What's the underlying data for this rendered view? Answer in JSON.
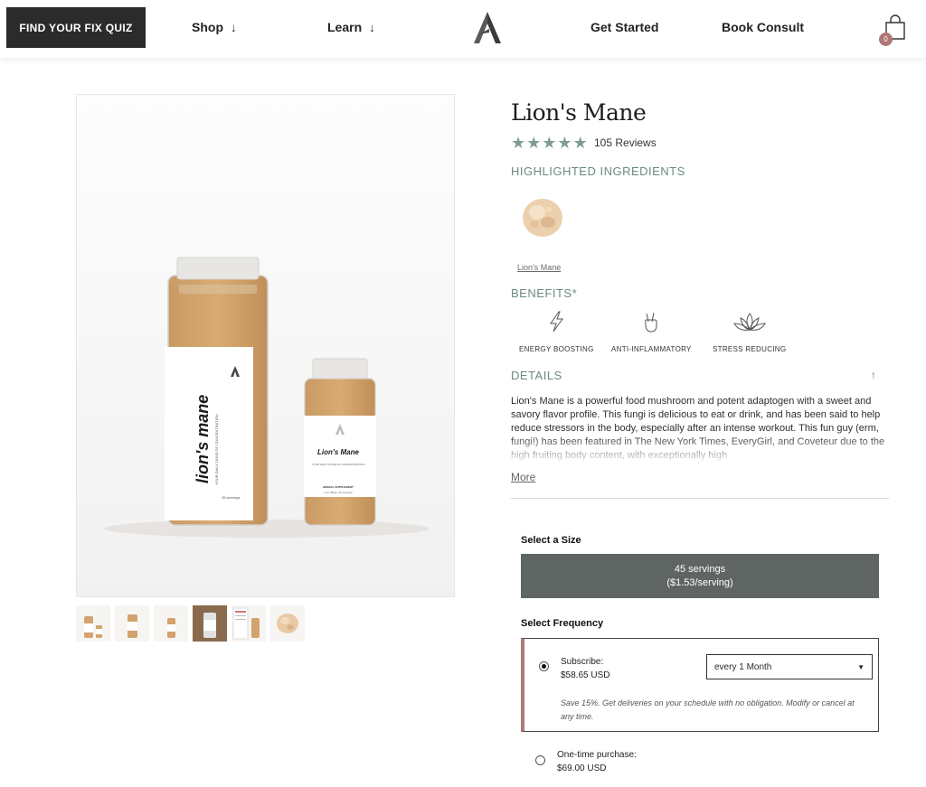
{
  "header": {
    "quiz_label": "FIND YOUR FIX QUIZ",
    "nav": {
      "shop": "Shop",
      "learn": "Learn",
      "get_started": "Get Started",
      "book_consult": "Book Consult"
    },
    "cart_count": "0"
  },
  "product": {
    "title": "Lion's Mane",
    "reviews": "105 Reviews",
    "rating_stars": 5,
    "highlighted_label": "HIGHLIGHTED INGREDIENTS",
    "ingredient_name": "Lion's Mane",
    "benefits_label": "BENEFITS*",
    "benefits": [
      "ENERGY BOOSTING",
      "ANTI-INFLAMMATORY",
      "STRESS REDUCING"
    ],
    "details_label": "DETAILS",
    "description": "Lion's Mane is a powerful food mushroom and potent adaptogen with a sweet and savory flavor profile. This fungi is delicious to eat or drink, and has been said to help reduce stressors in the body, especially after an intense workout. This fun guy (erm, fungi!) has been featured in The New York Times, EveryGirl, and Coveteur due to the high fruiting body content, with exceptionally high",
    "more_label": "More",
    "jar_large": {
      "name": "lion's mane",
      "tagline": "YOUR DAILY DOSE OF CONCENTRATION",
      "servings": "45 servings"
    },
    "jar_small": {
      "name": "Lion's Mane",
      "tagline": "YOUR DAILY DOSE OF CONCENTRATION",
      "type": "HERBAL SUPPLEMENT",
      "info": "2 oz (60g) | 12 servings"
    }
  },
  "purchase": {
    "size_label": "Select a Size",
    "size_line1": "45 servings",
    "size_line2": "($1.53/serving)",
    "frequency_label": "Select Frequency",
    "subscribe_label": "Subscribe:",
    "subscribe_price": "$58.65 USD",
    "frequency_value": "every 1 Month",
    "save_note": "Save 15%. Get deliveries on your schedule with no obligation. Modify or cancel at any time.",
    "one_time_label": "One-time purchase:",
    "one_time_price": "$69.00 USD"
  },
  "colors": {
    "accent_sage": "#6b8a85",
    "button_gray": "#5e6563",
    "accent_rose": "#b07777",
    "quiz_bg": "#2b2b2b"
  }
}
